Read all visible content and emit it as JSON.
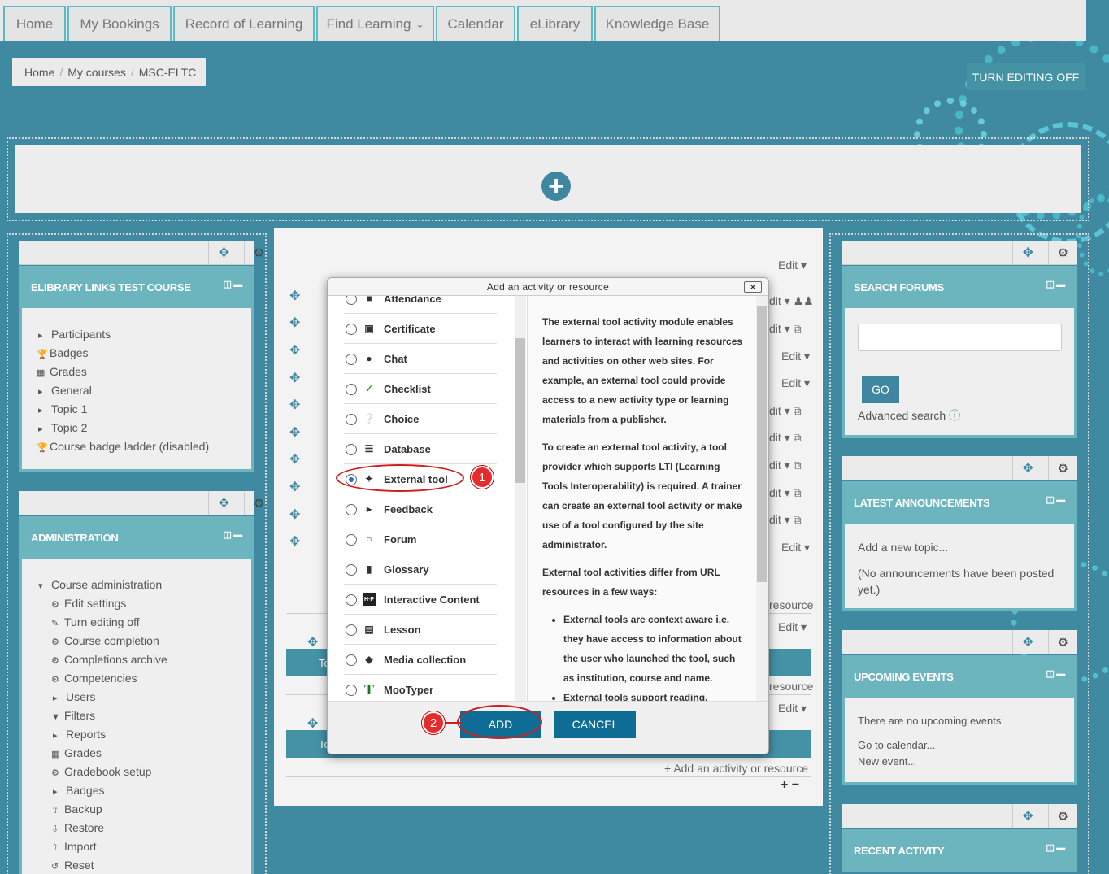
{
  "nav": {
    "tabs": [
      "Home",
      "My Bookings",
      "Record of Learning",
      "Find Learning",
      "Calendar",
      "eLibrary",
      "Knowledge Base"
    ]
  },
  "breadcrumb": [
    "Home",
    "My courses",
    "MSC-ELTC"
  ],
  "editing_button": "TURN EDITING OFF",
  "left_blocks": {
    "course": {
      "title": "ELIBRARY LINKS TEST COURSE",
      "items": [
        "Participants",
        "Badges",
        "Grades",
        "General",
        "Topic 1",
        "Topic 2",
        "Course badge ladder (disabled)"
      ]
    },
    "admin": {
      "title": "ADMINISTRATION",
      "items": [
        "Course administration",
        "Edit settings",
        "Turn editing off",
        "Course completion",
        "Completions archive",
        "Competencies",
        "Users",
        "Filters",
        "Reports",
        "Grades",
        "Gradebook setup",
        "Badges",
        "Backup",
        "Restore",
        "Import",
        "Reset"
      ]
    }
  },
  "center": {
    "edit_label": "Edit",
    "add_resource": "Add an activity or resource",
    "resource_suffix": "resource",
    "bar_letter": "To"
  },
  "dialog": {
    "title": "Add an activity or resource",
    "options": [
      "Attendance",
      "Certificate",
      "Chat",
      "Checklist",
      "Choice",
      "Database",
      "External tool",
      "Feedback",
      "Forum",
      "Glossary",
      "Interactive Content",
      "Lesson",
      "Media collection",
      "MooTyper"
    ],
    "selected": "External tool",
    "description": {
      "p1": "The external tool activity module enables learners to interact with learning resources and activities on other web sites. For example, an external tool could provide access to a new activity type or learning materials from a publisher.",
      "p2": "To create an external tool activity, a tool provider which supports LTI (Learning Tools Interoperability) is required. A trainer can create an external tool activity or make use of a tool configured by the site administrator.",
      "p3": "External tool activities differ from URL resources in a few ways:",
      "bullets": [
        "External tools are context aware i.e. they have access to information about the user who launched the tool, such as institution, course and name.",
        "External tools support reading,"
      ]
    },
    "add_button": "ADD",
    "cancel_button": "CANCEL"
  },
  "annotations": [
    "1",
    "2"
  ],
  "right_blocks": {
    "search": {
      "title": "SEARCH FORUMS",
      "go": "GO",
      "advanced": "Advanced search"
    },
    "announcements": {
      "title": "LATEST ANNOUNCEMENTS",
      "add": "Add a new topic...",
      "none": "(No announcements have been posted yet.)"
    },
    "events": {
      "title": "UPCOMING EVENTS",
      "none": "There are no upcoming events",
      "goto": "Go to calendar...",
      "new": "New event..."
    },
    "recent": {
      "title": "RECENT ACTIVITY"
    }
  }
}
